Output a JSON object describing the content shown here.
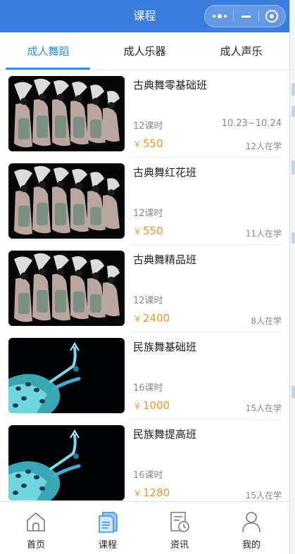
{
  "titlebar": {
    "title": "课程"
  },
  "tabs": [
    {
      "label": "成人舞蹈",
      "active": true
    },
    {
      "label": "成人乐器",
      "active": false
    },
    {
      "label": "成人声乐",
      "active": false
    }
  ],
  "courses": [
    {
      "name": "古典舞零基础班",
      "lessons": "12课时",
      "dates": "10.23~10.24",
      "currency": "￥",
      "price": "550",
      "enrolled": "12人在学",
      "image": "fan-dance-photo"
    },
    {
      "name": "古典舞红花班",
      "lessons": "12课时",
      "dates": "",
      "currency": "￥",
      "price": "550",
      "enrolled": "11人在学",
      "image": "fan-dance-photo"
    },
    {
      "name": "古典舞精品班",
      "lessons": "12课时",
      "dates": "",
      "currency": "￥",
      "price": "2400",
      "enrolled": "8人在学",
      "image": "fan-dance-photo"
    },
    {
      "name": "民族舞基础班",
      "lessons": "16课时",
      "dates": "",
      "currency": "￥",
      "price": "1000",
      "enrolled": "15人在学",
      "image": "peacock-dance-photo"
    },
    {
      "name": "民族舞提高班",
      "lessons": "16课时",
      "dates": "",
      "currency": "￥",
      "price": "1280",
      "enrolled": "15人在学",
      "image": "peacock-dance-photo"
    }
  ],
  "bottom_nav": [
    {
      "label": "首页",
      "icon": "home-icon",
      "active": false
    },
    {
      "label": "课程",
      "icon": "course-icon",
      "active": true
    },
    {
      "label": "资讯",
      "icon": "news-icon",
      "active": false
    },
    {
      "label": "我的",
      "icon": "user-icon",
      "active": false
    }
  ],
  "colors": {
    "titlebar": "#3b7ddd",
    "accent": "#2f8fe0",
    "price": "#f0932b",
    "muted": "#8a8a8a"
  }
}
